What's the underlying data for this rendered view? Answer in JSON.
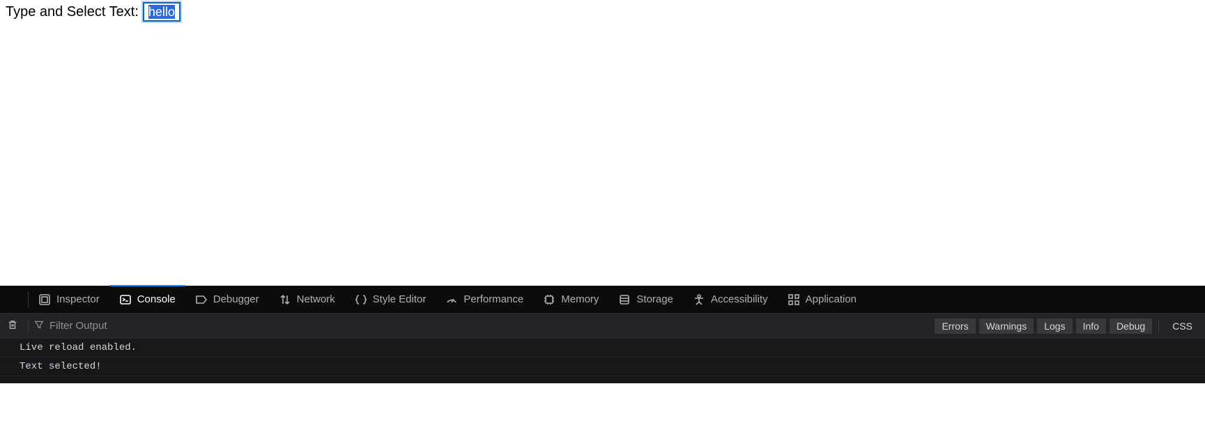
{
  "page": {
    "label": "Type and Select Text:",
    "input_value": "hello"
  },
  "devtools": {
    "tabs": {
      "inspector": "Inspector",
      "console": "Console",
      "debugger": "Debugger",
      "network": "Network",
      "style_editor": "Style Editor",
      "performance": "Performance",
      "memory": "Memory",
      "storage": "Storage",
      "accessibility": "Accessibility",
      "application": "Application"
    },
    "toolbar": {
      "filter_placeholder": "Filter Output",
      "pills": {
        "errors": "Errors",
        "warnings": "Warnings",
        "logs": "Logs",
        "info": "Info",
        "debug": "Debug",
        "css": "CSS"
      }
    },
    "log": [
      "Live reload enabled.",
      "Text selected!"
    ]
  }
}
